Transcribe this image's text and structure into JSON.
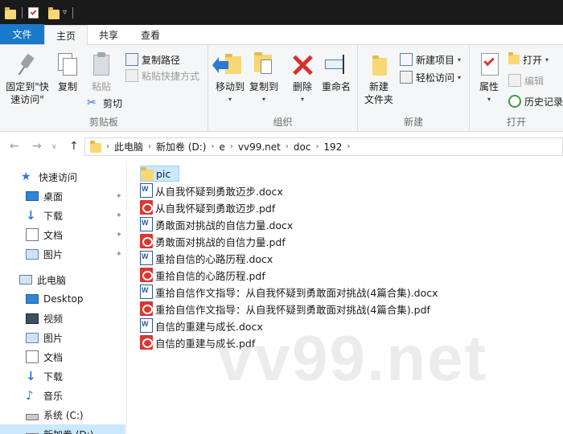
{
  "tabs": [
    "文件",
    "主页",
    "共享",
    "查看"
  ],
  "ribbon": {
    "clipboard": {
      "label": "剪贴板",
      "pin_quick": "固定到\"快\n速访问\"",
      "copy": "复制",
      "paste": "粘贴",
      "copy_path": "复制路径",
      "paste_shortcut": "粘贴快捷方式",
      "cut": "剪切"
    },
    "organize": {
      "label": "组织",
      "move_to": "移动到",
      "copy_to": "复制到",
      "delete": "删除",
      "rename": "重命名"
    },
    "new": {
      "label": "新建",
      "new_folder": "新建\n文件夹",
      "new_item": "新建项目",
      "easy_access": "轻松访问"
    },
    "open": {
      "label": "打开",
      "properties": "属性",
      "open": "打开",
      "edit": "编辑",
      "history": "历史记录"
    }
  },
  "address": {
    "crumbs": [
      "此电脑",
      "新加卷 (D:)",
      "e",
      "vv99.net",
      "doc",
      "192"
    ]
  },
  "nav": {
    "quick_access": "快速访问",
    "quick_items": [
      "桌面",
      "下载",
      "文档",
      "图片"
    ],
    "this_pc": "此电脑",
    "pc_items": [
      "Desktop",
      "视频",
      "图片",
      "文档",
      "下载",
      "音乐",
      "系统 (C:)",
      "新加卷 (D:)"
    ]
  },
  "files": [
    {
      "name": "pic",
      "type": "folder"
    },
    {
      "name": "从自我怀疑到勇敢迈步.docx",
      "type": "docx"
    },
    {
      "name": "从自我怀疑到勇敢迈步.pdf",
      "type": "pdf"
    },
    {
      "name": "勇敢面对挑战的自信力量.docx",
      "type": "docx"
    },
    {
      "name": "勇敢面对挑战的自信力量.pdf",
      "type": "pdf"
    },
    {
      "name": "重拾自信的心路历程.docx",
      "type": "docx"
    },
    {
      "name": "重拾自信的心路历程.pdf",
      "type": "pdf"
    },
    {
      "name": "重拾自信作文指导：从自我怀疑到勇敢面对挑战(4篇合集).docx",
      "type": "docx"
    },
    {
      "name": "重拾自信作文指导：从自我怀疑到勇敢面对挑战(4篇合集).pdf",
      "type": "pdf"
    },
    {
      "name": "自信的重建与成长.docx",
      "type": "docx"
    },
    {
      "name": "自信的重建与成长.pdf",
      "type": "pdf"
    }
  ],
  "watermark": "vv99.net",
  "colors": {
    "accent": "#1979ca",
    "selection": "#cce8ff"
  }
}
